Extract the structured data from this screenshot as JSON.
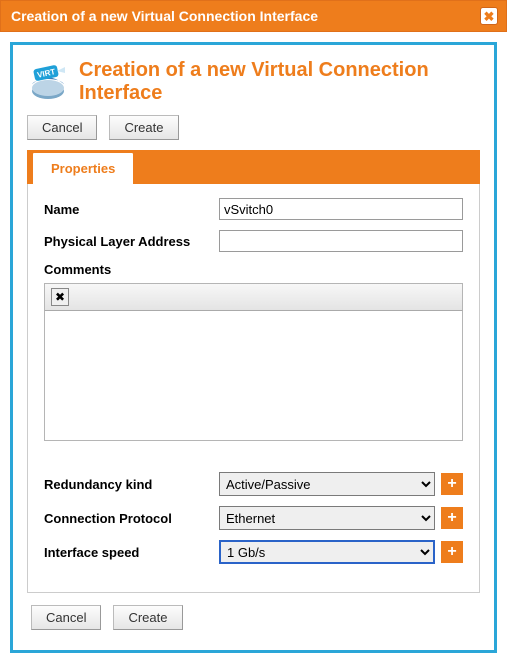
{
  "dialog": {
    "title": "Creation of a new Virtual Connection Interface",
    "icon_label": "VIRT"
  },
  "header": {
    "title": "Creation of a new Virtual Connection Interface"
  },
  "buttons": {
    "cancel": "Cancel",
    "create": "Create"
  },
  "tabs": {
    "properties": "Properties"
  },
  "form": {
    "name_label": "Name",
    "name_value": "vSvitch0",
    "pla_label": "Physical Layer Address",
    "pla_value": "",
    "comments_label": "Comments",
    "comments_value": "",
    "redundancy_label": "Redundancy kind",
    "redundancy_value": "Active/Passive",
    "protocol_label": "Connection Protocol",
    "protocol_value": "Ethernet",
    "speed_label": "Interface speed",
    "speed_value": "1 Gb/s"
  },
  "icons": {
    "close": "✖",
    "tool_x": "✖",
    "plus": "+"
  }
}
